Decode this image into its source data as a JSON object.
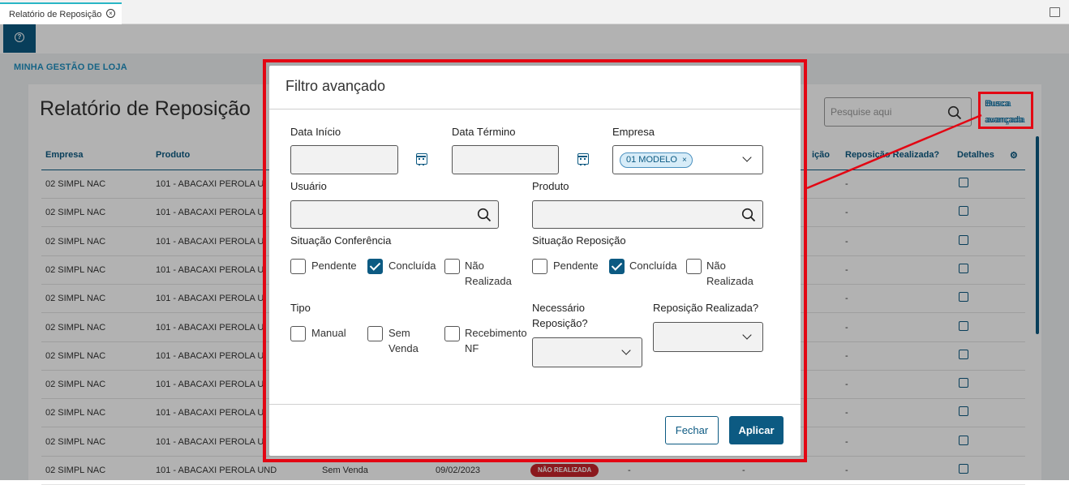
{
  "tab": {
    "label": "Relatório de Reposição"
  },
  "breadcrumb": "MINHA GESTÃO DE LOJA",
  "report": {
    "title": "Relatório de Reposição",
    "search_placeholder": "Pesquise aqui",
    "advanced_search_label": "Busca avançada",
    "columns": [
      "Empresa",
      "Produto",
      "ição",
      "Reposição Realizada?",
      "Detalhes"
    ],
    "rows": [
      {
        "empresa": "02 SIMPL NAC",
        "produto": "101 - ABACAXI PEROLA U",
        "realizada": "-"
      },
      {
        "empresa": "02 SIMPL NAC",
        "produto": "101 - ABACAXI PEROLA U",
        "realizada": "-"
      },
      {
        "empresa": "02 SIMPL NAC",
        "produto": "101 - ABACAXI PEROLA U",
        "realizada": "-"
      },
      {
        "empresa": "02 SIMPL NAC",
        "produto": "101 - ABACAXI PEROLA U",
        "realizada": "-"
      },
      {
        "empresa": "02 SIMPL NAC",
        "produto": "101 - ABACAXI PEROLA U",
        "realizada": "-"
      },
      {
        "empresa": "02 SIMPL NAC",
        "produto": "101 - ABACAXI PEROLA U",
        "realizada": "-"
      },
      {
        "empresa": "02 SIMPL NAC",
        "produto": "101 - ABACAXI PEROLA U",
        "realizada": "-"
      },
      {
        "empresa": "02 SIMPL NAC",
        "produto": "101 - ABACAXI PEROLA U",
        "realizada": "-"
      },
      {
        "empresa": "02 SIMPL NAC",
        "produto": "101 - ABACAXI PEROLA U",
        "realizada": "-"
      },
      {
        "empresa": "02 SIMPL NAC",
        "produto": "101 - ABACAXI PEROLA U",
        "realizada": "-"
      }
    ],
    "last_row": {
      "empresa": "02 SIMPL NAC",
      "produto": "101 - ABACAXI PEROLA UND",
      "tipo": "Sem Venda",
      "data": "09/02/2023",
      "status": "NÃO REALIZADA",
      "c1": "-",
      "c2": "-",
      "realizada": "-"
    }
  },
  "modal": {
    "title": "Filtro avançado",
    "data_inicio_label": "Data Início",
    "data_termino_label": "Data Término",
    "empresa_label": "Empresa",
    "empresa_tag": "01 MODELO",
    "usuario_label": "Usuário",
    "produto_label": "Produto",
    "sit_conferencia_label": "Situação Conferência",
    "sit_conferencia": [
      {
        "label": "Pendente",
        "checked": false
      },
      {
        "label": "Concluída",
        "checked": true
      },
      {
        "label_line1": "Não",
        "label_line2": "Realizada",
        "checked": false
      }
    ],
    "sit_reposicao_label": "Situação Reposição",
    "sit_reposicao": [
      {
        "label": "Pendente",
        "checked": false
      },
      {
        "label": "Concluída",
        "checked": true
      },
      {
        "label_line1": "Não",
        "label_line2": "Realizada",
        "checked": false
      }
    ],
    "tipo_label": "Tipo",
    "tipo": [
      {
        "label": "Manual",
        "checked": false
      },
      {
        "label_line1": "Sem",
        "label_line2": "Venda",
        "checked": false
      },
      {
        "label_line1": "Recebimento",
        "label_line2": "NF",
        "checked": false
      }
    ],
    "necessario_label_line1": "Necessário",
    "necessario_label_line2": "Reposição?",
    "realizada_label": "Reposição Realizada?",
    "close_label": "Fechar",
    "apply_label": "Aplicar"
  },
  "colors": {
    "primary": "#0c5a82",
    "highlight": "#e30613",
    "danger_pill": "#c7242b"
  }
}
